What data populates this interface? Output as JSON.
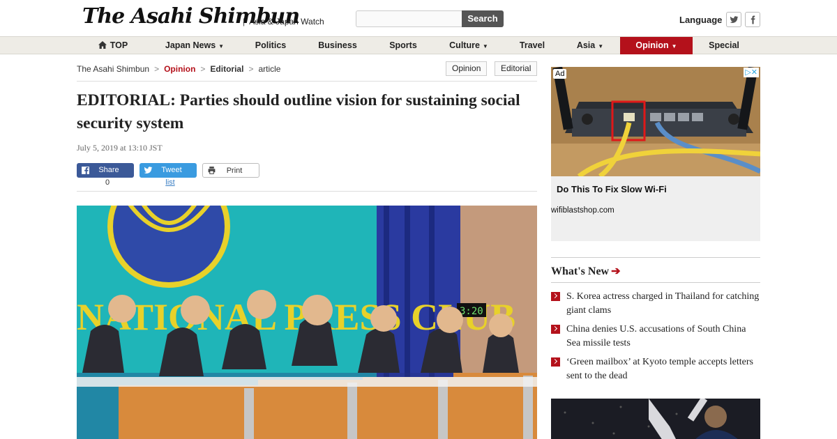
{
  "header": {
    "logo": "The Asahi Shimbun",
    "tagline": "Asia & Japan Watch",
    "search_placeholder": "",
    "search_label": "Search",
    "language_label": "Language"
  },
  "nav": {
    "items": [
      {
        "label": "TOP"
      },
      {
        "label": "Japan News"
      },
      {
        "label": "Politics"
      },
      {
        "label": "Business"
      },
      {
        "label": "Sports"
      },
      {
        "label": "Culture"
      },
      {
        "label": "Travel"
      },
      {
        "label": "Asia"
      },
      {
        "label": "Opinion"
      },
      {
        "label": "Special"
      }
    ],
    "caret": "▼"
  },
  "breadcrumb": {
    "home": "The Asahi Shimbun",
    "section": "Opinion",
    "subsection": "Editorial",
    "current": "article",
    "sep": ">"
  },
  "tags": [
    "Opinion",
    "Editorial"
  ],
  "article": {
    "title": "EDITORIAL: Parties should outline vision for sustaining social security system",
    "date": "July 5, 2019 at 13:10 JST",
    "share_label": "Share",
    "share_count": "0",
    "tweet_label": "Tweet",
    "tweet_link": "list",
    "print_label": "Print"
  },
  "photo": {
    "sign_text": "NATIONAL PRESS CLUB",
    "clock_text": "3:20"
  },
  "ad": {
    "badge": "Ad",
    "choice": "▷✕",
    "headline": "Do This To Fix Slow Wi-Fi",
    "source": "wifiblastshop.com"
  },
  "whats_new": {
    "title": "What's New",
    "items": [
      {
        "text": "S. Korea actress charged in Thailand for catching giant clams"
      },
      {
        "text": "China denies U.S. accusations of South China Sea missile tests"
      },
      {
        "text": "‘Green mailbox’ at Kyoto temple accepts letters sent to the dead"
      }
    ]
  },
  "colors": {
    "brand_red": "#b4111b",
    "facebook": "#3b5998",
    "twitter": "#1da1f2"
  }
}
